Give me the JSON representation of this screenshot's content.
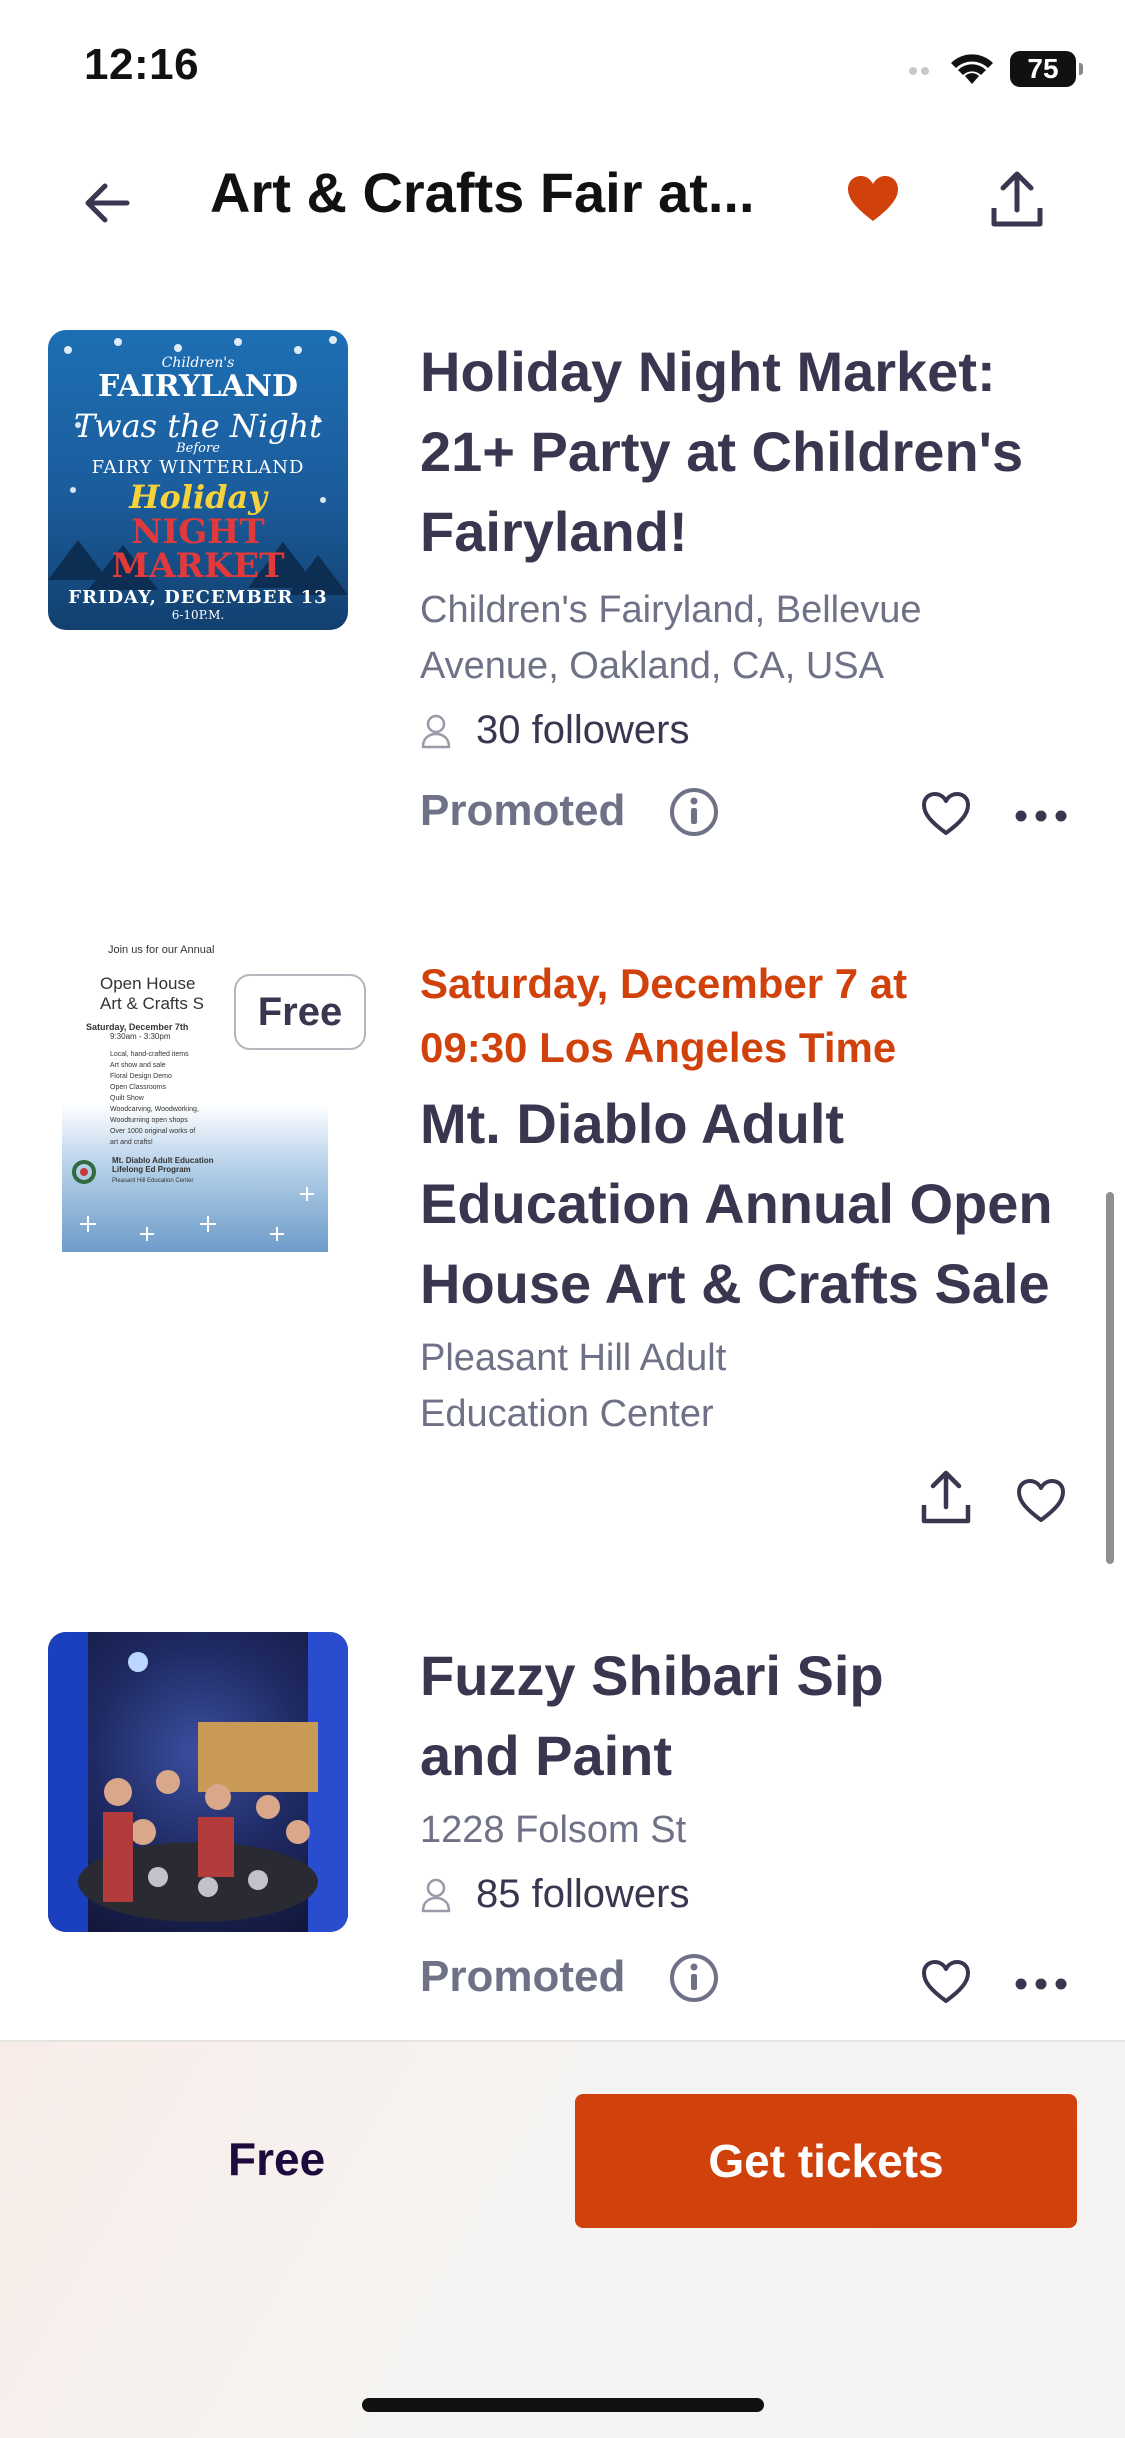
{
  "status_bar": {
    "time": "12:16",
    "battery": "75"
  },
  "header": {
    "title": "Art & Crafts Fair at..."
  },
  "events": [
    {
      "title_lines": [
        "Holiday Night Market:",
        "21+ Party at Children's",
        "Fairyland!"
      ],
      "location_lines": [
        "Children's Fairyland, Bellevue",
        "Avenue, Oakland, CA, USA"
      ],
      "followers": "30 followers",
      "promoted": "Promoted",
      "thumb_text": {
        "line1": "Children's",
        "line2": "FAIRYLAND",
        "line3": "Twas the Night",
        "line4": "Before",
        "line5": "FAIRY WINTERLAND",
        "line6": "Holiday",
        "line7": "NIGHT MARKET",
        "line8": "FRIDAY, DECEMBER 13",
        "line9": "6-10P.M."
      }
    },
    {
      "date_lines": [
        "Saturday, December 7 at",
        "09:30 Los Angeles Time"
      ],
      "title_lines": [
        "Mt. Diablo Adult",
        "Education Annual Open",
        "House Art & Crafts Sale"
      ],
      "location_lines": [
        "Pleasant Hill Adult",
        "Education Center"
      ],
      "badge": "Free",
      "thumb_text": {
        "line1": "Join us for our Annual",
        "line2": "Open House",
        "line3": "Art & Crafts S",
        "line4": "Saturday, December 7th",
        "line5": "9:30am - 3:30pm",
        "bullets": [
          "Local, hand-crafted items",
          "Art show and sale",
          "Floral Design Demo",
          "Open Classrooms",
          "Quilt Show",
          "Woodcarving, Woodworking,",
          "Woodturning open shops",
          "Over 1000 original works of",
          "art and crafts!"
        ],
        "footer1": "Mt. Diablo Adult Education",
        "footer2": "Lifelong Ed Program",
        "footer3": "Pleasant Hill Education Center"
      }
    },
    {
      "title_lines": [
        "Fuzzy Shibari Sip",
        "and Paint"
      ],
      "location_lines": [
        "1228 Folsom St"
      ],
      "followers": "85 followers",
      "promoted": "Promoted"
    }
  ],
  "footer": {
    "price": "Free",
    "cta": "Get tickets"
  },
  "colors": {
    "accent": "#d1410c",
    "text": "#39364f",
    "muted": "#6f7287"
  },
  "icons": [
    "back-arrow-icon",
    "heart-filled-icon",
    "share-icon",
    "user-icon",
    "info-icon",
    "heart-outline-icon",
    "more-icon",
    "wifi-icon",
    "signal-icon",
    "battery-icon"
  ]
}
